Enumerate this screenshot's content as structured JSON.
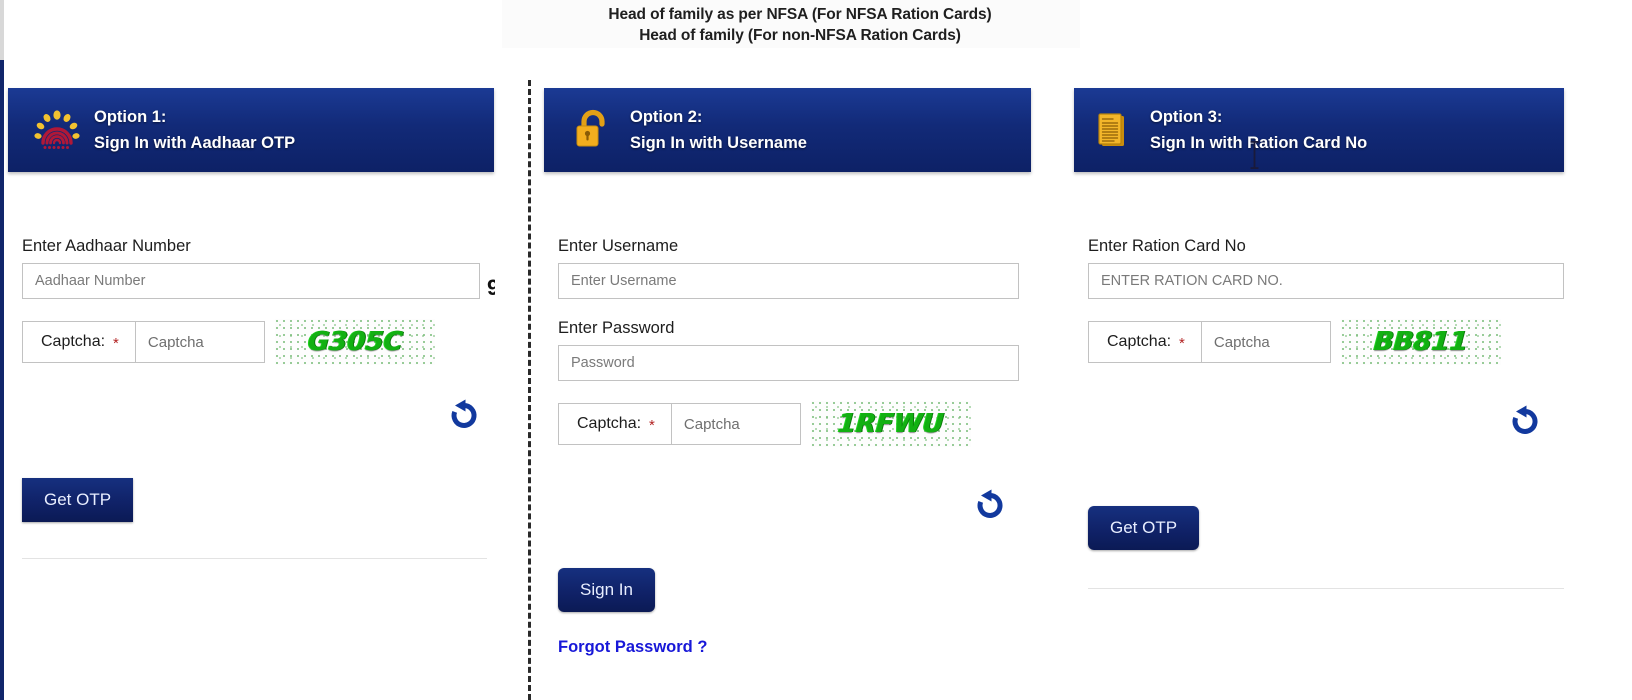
{
  "header": {
    "line1": "Head of family as per NFSA (For NFSA Ration Cards)",
    "line2": "Head of family (For non-NFSA Ration Cards)"
  },
  "colors": {
    "header_blue": "#122a78",
    "button_navy": "#102268",
    "link_blue": "#1818d8",
    "captcha_green": "#12b012",
    "required_red": "#b22222",
    "icon_blue": "#12399e",
    "icon_amber": "#f0a81e"
  },
  "columns": [
    {
      "option_number": "Option 1:",
      "option_title": "Sign In with Aadhaar OTP",
      "icon": "aadhaar-logo-icon",
      "fields": [
        {
          "label": "Enter Aadhaar Number",
          "placeholder": "Aadhaar Number",
          "value": ""
        }
      ],
      "captcha": {
        "label": "Captcha:",
        "required_mark": "*",
        "input_placeholder": "Captcha",
        "input_value": "",
        "image_text": "G305C",
        "refresh_icon": "refresh-icon"
      },
      "submit_label": "Get OTP"
    },
    {
      "option_number": "Option 2:",
      "option_title": "Sign In with Username",
      "icon": "open-padlock-icon",
      "fields": [
        {
          "label": "Enter Username",
          "placeholder": "Enter Username",
          "value": ""
        },
        {
          "label": "Enter Password",
          "placeholder": "Password",
          "value": ""
        }
      ],
      "captcha": {
        "label": "Captcha:",
        "required_mark": "*",
        "input_placeholder": "Captcha",
        "input_value": "",
        "image_text": "1RFWU",
        "refresh_icon": "refresh-icon"
      },
      "submit_label": "Sign In",
      "forgot_password_label": "Forgot Password ?"
    },
    {
      "option_number": "Option 3:",
      "option_title": "Sign In with Ration Card No",
      "icon": "document-icon",
      "fields": [
        {
          "label": "Enter Ration Card No",
          "placeholder": "ENTER RATION CARD NO.",
          "value": ""
        }
      ],
      "captcha": {
        "label": "Captcha:",
        "required_mark": "*",
        "input_placeholder": "Captcha",
        "input_value": "",
        "image_text": "BB811",
        "refresh_icon": "refresh-icon"
      },
      "submit_label": "Get OTP"
    }
  ],
  "misc": {
    "clipped_glyph": "9"
  }
}
